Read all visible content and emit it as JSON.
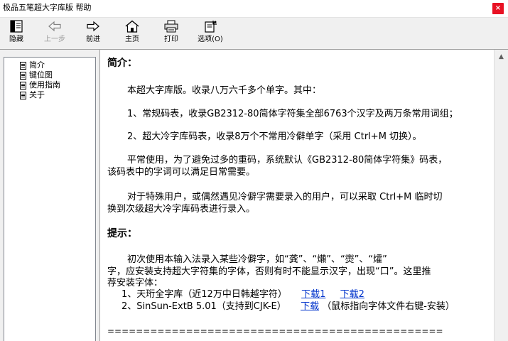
{
  "window": {
    "title": "极品五笔超大字库版 帮助",
    "close_glyph": "×"
  },
  "toolbar": {
    "hide": "隐藏",
    "back": "上一步",
    "forward": "前进",
    "home": "主页",
    "print": "打印",
    "options": "选项(O)"
  },
  "sidebar": {
    "items": [
      "简介",
      "键位图",
      "使用指南",
      "关于"
    ]
  },
  "content": {
    "intro_heading": "简介：",
    "intro_lines": [
      "本超大字库版。收录八万六千多个单字。其中：",
      "1、常规码表，收录GB2312-80简体字符集全部6763个汉字及两万条常用词组；",
      "2、超大冷字库码表，收录8万个不常用冷僻单字（采用 Ctrl+M 切换）。"
    ],
    "para1_line1": "平常使用，为了避免过多的重码，系统默认《GB2312-80简体字符集》码表，",
    "para1_line2": "该码表中的字词可以满足日常需要。",
    "para2_line1": "对于特殊用户，或偶然遇见冷僻字需要录入的用户，可以采取 Ctrl+M 临时切",
    "para2_line2": "换到次级超大冷字库码表进行录入。",
    "tips_heading": "提示：",
    "tips_line1": "初次使用本输入法录入某些冷僻字，如“龚”、“㸊”、“㸉”、“㸌”",
    "tips_line2": "字，应安装支持超大字符集的字体，否则有时不能显示汉字，出现“口”。这里推",
    "tips_line3": "荐安装字体：",
    "font1_label": "1、天珩全字库（近12万中日韩越字符）",
    "font1_link1": "下载1",
    "font1_link2": "下载2",
    "font2_label": "2、SinSun-ExtB 5.01（支持到CJK-E）",
    "font2_link": "下载",
    "font2_note": "（鼠标指向字体文件右键-安装）",
    "separator": "==============================================="
  },
  "scrollbar": {
    "up_arrow": "▲"
  }
}
